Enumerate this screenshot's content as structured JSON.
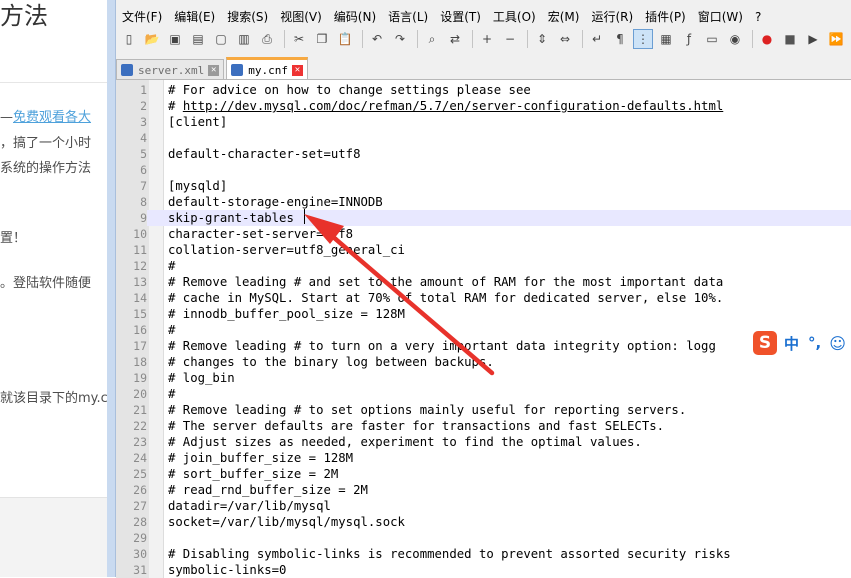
{
  "background_page": {
    "title": "方法",
    "lines": [
      {
        "prefix": "—",
        "link": "免费观看各大"
      },
      {
        "text": "，搞了一个小时"
      },
      {
        "text": "系统的操作方法"
      },
      {
        "text": "置！"
      },
      {
        "text": "。登陆软件随便"
      },
      {
        "text": "就该目录下的my.c"
      }
    ]
  },
  "menu": [
    "文件(F)",
    "编辑(E)",
    "搜索(S)",
    "视图(V)",
    "编码(N)",
    "语言(L)",
    "设置(T)",
    "工具(O)",
    "宏(M)",
    "运行(R)",
    "插件(P)",
    "窗口(W)",
    "?"
  ],
  "toolbar": [
    "new-file",
    "open-file",
    "save",
    "save-all",
    "close",
    "close-all",
    "print",
    "sep",
    "cut",
    "copy",
    "paste",
    "sep",
    "undo",
    "redo",
    "sep",
    "find",
    "replace",
    "sep",
    "zoom-in",
    "zoom-out",
    "sep",
    "sync-v",
    "sync-h",
    "sep",
    "word-wrap",
    "show-all-chars",
    "indent-guide",
    "doc-map",
    "function-list",
    "folder-workspace",
    "monitor",
    "sep",
    "record-macro",
    "stop-record",
    "play-macro",
    "run-macro-multi"
  ],
  "tabs": [
    {
      "name": "server.xml",
      "active": false
    },
    {
      "name": "my.cnf",
      "active": true
    }
  ],
  "editor": {
    "current_line": 9,
    "lines": [
      {
        "n": "1",
        "text": "# For advice on how to change settings please see"
      },
      {
        "n": "2",
        "prefix": "# ",
        "link": "http://dev.mysql.com/doc/refman/5.7/en/server-configuration-defaults.html"
      },
      {
        "n": "3",
        "text": "[client]"
      },
      {
        "n": "4",
        "text": ""
      },
      {
        "n": "5",
        "text": "default-character-set=utf8"
      },
      {
        "n": "6",
        "text": ""
      },
      {
        "n": "7",
        "text": "[mysqld]"
      },
      {
        "n": "8",
        "text": "default-storage-engine=INNODB"
      },
      {
        "n": "9",
        "text": "skip-grant-tables"
      },
      {
        "n": "10",
        "text": "character-set-server=utf8"
      },
      {
        "n": "11",
        "text": "collation-server=utf8_general_ci"
      },
      {
        "n": "12",
        "text": "#"
      },
      {
        "n": "13",
        "text": "# Remove leading # and set to the amount of RAM for the most important data"
      },
      {
        "n": "14",
        "text": "# cache in MySQL. Start at 70% of total RAM for dedicated server, else 10%."
      },
      {
        "n": "15",
        "text": "# innodb_buffer_pool_size = 128M"
      },
      {
        "n": "16",
        "text": "#"
      },
      {
        "n": "17",
        "text": "# Remove leading # to turn on a very important data integrity option: logg"
      },
      {
        "n": "18",
        "text": "# changes to the binary log between backups."
      },
      {
        "n": "19",
        "text": "# log_bin"
      },
      {
        "n": "20",
        "text": "#"
      },
      {
        "n": "21",
        "text": "# Remove leading # to set options mainly useful for reporting servers."
      },
      {
        "n": "22",
        "text": "# The server defaults are faster for transactions and fast SELECTs."
      },
      {
        "n": "23",
        "text": "# Adjust sizes as needed, experiment to find the optimal values."
      },
      {
        "n": "24",
        "text": "# join_buffer_size = 128M"
      },
      {
        "n": "25",
        "text": "# sort_buffer_size = 2M"
      },
      {
        "n": "26",
        "text": "# read_rnd_buffer_size = 2M"
      },
      {
        "n": "27",
        "text": "datadir=/var/lib/mysql"
      },
      {
        "n": "28",
        "text": "socket=/var/lib/mysql/mysql.sock"
      },
      {
        "n": "29",
        "text": ""
      },
      {
        "n": "30",
        "text": "# Disabling symbolic-links is recommended to prevent assorted security risks"
      },
      {
        "n": "31",
        "text": "symbolic-links=0"
      }
    ]
  },
  "ime_bar": {
    "logo": "S",
    "mode": "中",
    "punct": "°,",
    "emoji": "☺"
  },
  "colors": {
    "active_tab_accent": "#f7a941",
    "current_line": "#e8e8ff",
    "annotation_arrow": "#e8322b",
    "link": "#4ea1db"
  }
}
